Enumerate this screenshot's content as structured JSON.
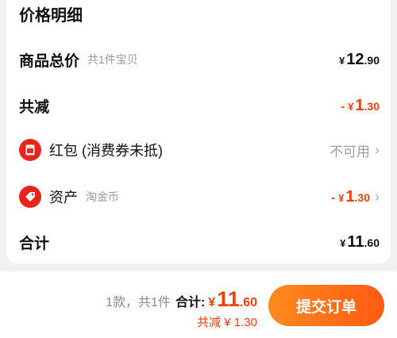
{
  "price_detail": {
    "title": "价格明细",
    "goods_total": {
      "label": "商品总价",
      "sub": "共1件宝贝",
      "yen": "¥",
      "int": "12",
      "dec": ".90"
    },
    "discount_total": {
      "label": "共减",
      "minus": "-",
      "yen": "¥",
      "int": "1",
      "dec": ".30"
    },
    "red_packet": {
      "label": "红包 (消费券未抵)",
      "status": "不可用",
      "icon": "red-packet-icon"
    },
    "assets": {
      "label": "资产",
      "sub": "淘金币",
      "minus": "-",
      "yen": "¥",
      "int": "1",
      "dec": ".30",
      "icon": "tag-icon"
    },
    "sum": {
      "label": "合计",
      "yen": "¥",
      "int": "11",
      "dec": ".60"
    }
  },
  "footer": {
    "count_text": "1款，共1件",
    "total_label": "合计:",
    "yen": "¥",
    "int": "11",
    "dec": ".60",
    "discount_text": "共减 ¥ 1.30",
    "submit_label": "提交订单"
  },
  "colors": {
    "accent": "#f0400a",
    "icon_red": "#e8241b",
    "button_start": "#ff8a1f",
    "button_end": "#ff5a12"
  }
}
